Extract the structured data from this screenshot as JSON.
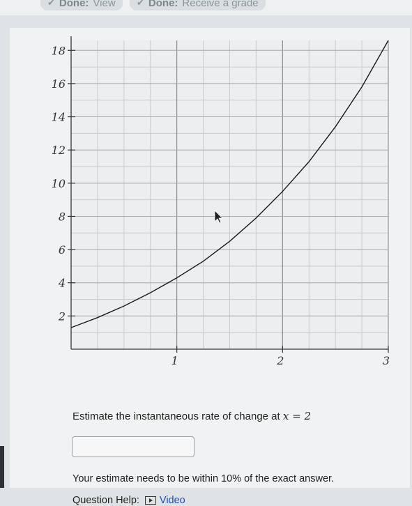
{
  "topbar": {
    "item1": {
      "bold": "Done:",
      "text": "View"
    },
    "item2": {
      "bold": "Done:",
      "text": "Receive a grade"
    }
  },
  "chart_data": {
    "type": "line",
    "xlim": [
      0,
      3
    ],
    "ylim": [
      0,
      18.6
    ],
    "x_ticks": [
      1,
      2,
      3
    ],
    "x_tick_labels": [
      "1",
      "2",
      "3"
    ],
    "y_ticks": [
      2,
      4,
      6,
      8,
      10,
      12,
      14,
      16,
      18
    ],
    "y_tick_labels": [
      "2",
      "4",
      "6",
      "8",
      "10",
      "12",
      "14",
      "16",
      "18"
    ],
    "x_minor_step": 0.25,
    "y_minor_step": 1,
    "grid": true,
    "series": [
      {
        "x": [
          0,
          0.25,
          0.5,
          0.75,
          1,
          1.25,
          1.5,
          1.75,
          2,
          2.25,
          2.5,
          2.75,
          3
        ],
        "y": [
          1.3,
          1.9,
          2.6,
          3.4,
          4.3,
          5.3,
          6.5,
          7.9,
          9.5,
          11.3,
          13.4,
          15.8,
          18.6
        ]
      }
    ],
    "line_color": "#1a1a1a"
  },
  "question": {
    "prompt_prefix": "Estimate the instantaneous rate of change at",
    "math": "x = 2",
    "answer_value": ""
  },
  "note": "Your estimate needs to be within 10% of the exact answer.",
  "help": {
    "label": "Question Help:",
    "video_label": "Video",
    "video_icon": "play-video-icon"
  }
}
